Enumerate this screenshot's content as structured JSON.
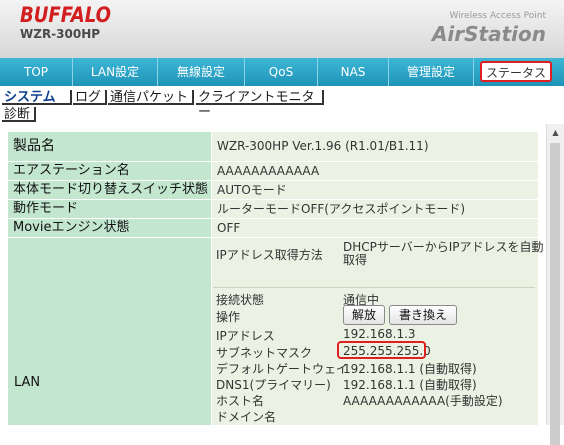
{
  "header": {
    "brand": "BUFFALO",
    "model": "WZR-300HP",
    "tagline": "Wireless Access Point",
    "product": "AirStation"
  },
  "nav": {
    "items": [
      "TOP",
      "LAN設定",
      "無線設定",
      "QoS",
      "NAS",
      "管理設定",
      "ステータス"
    ],
    "active": "ステータス"
  },
  "subtabs": [
    "システム",
    "ログ",
    "通信パケット",
    "クライアントモニター",
    "診断"
  ],
  "rows": [
    {
      "label": "製品名",
      "value": "WZR-300HP Ver.1.96 (R1.01/B1.11)"
    },
    {
      "label": "エアステーション名",
      "value": "AAAAAAAAAAAA"
    },
    {
      "label": "本体モード切り替えスイッチ状態",
      "value": "AUTOモード"
    },
    {
      "label": "動作モード",
      "value": "ルーターモードOFF(アクセスポイントモード)"
    },
    {
      "label": "Movieエンジン状態",
      "value": "OFF"
    }
  ],
  "lan": {
    "label": "LAN",
    "ip_method_label": "IPアドレス取得方法",
    "ip_method_value": "DHCPサーバーからIPアドレスを自動取得",
    "ip_method_line1": "DHCPサーバーからIPアドレスを自動",
    "ip_method_line2": "取得",
    "conn_label": "接続状態",
    "conn_value": "通信中",
    "op_label": "操作",
    "release_button": "解放",
    "rewrite_button": "書き換え",
    "ip_label": "IPアドレス",
    "ip_value": "192.168.1.3",
    "mask_label": "サブネットマスク",
    "mask_value": "255.255.255.0",
    "gw_label": "デフォルトゲートウェイ",
    "gw_value": "192.168.1.1 (自動取得)",
    "dns_label": "DNS1(プライマリー)",
    "dns_value": "192.168.1.1 (自動取得)",
    "host_label": "ホスト名",
    "host_value": "AAAAAAAAAAAA(手動設定)",
    "domain_label": "ドメイン名",
    "domain_value": ""
  },
  "colors": {
    "nav_bg": "#2aa6c9",
    "label_bg": "#c3e6cf",
    "value_bg": "#ecf2e3",
    "highlight": "#e02020",
    "brand": "#d21e1e"
  }
}
